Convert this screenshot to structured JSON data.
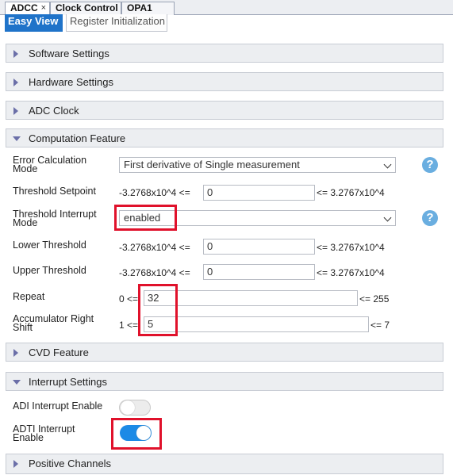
{
  "doc_tabs": [
    {
      "label": "ADCC",
      "close": "×"
    },
    {
      "label": "Clock Control"
    },
    {
      "label": "OPA1"
    }
  ],
  "view_tabs": {
    "active": "Easy View",
    "inactive": "Register Initialization"
  },
  "sections": {
    "software": "Software Settings",
    "hardware": "Hardware Settings",
    "adc_clock": "ADC Clock",
    "computation": "Computation Feature",
    "cvd": "CVD Feature",
    "interrupt": "Interrupt Settings",
    "positive": "Positive Channels"
  },
  "computation": {
    "error_calc": {
      "label_line1": "Error Calculation",
      "label_line2": "Mode",
      "value": "First derivative of Single measurement"
    },
    "threshold_setpoint": {
      "label": "Threshold Setpoint",
      "min": "-3.2768x10^4 <=",
      "value": "0",
      "max": "<= 3.2767x10^4"
    },
    "threshold_interrupt": {
      "label_line1": "Threshold Interrupt",
      "label_line2": "Mode",
      "value": "enabled"
    },
    "lower_threshold": {
      "label": "Lower Threshold",
      "min": "-3.2768x10^4 <=",
      "value": "0",
      "max": "<= 3.2767x10^4"
    },
    "upper_threshold": {
      "label": "Upper Threshold",
      "min": "-3.2768x10^4 <=",
      "value": "0",
      "max": "<= 3.2767x10^4"
    },
    "repeat": {
      "label": "Repeat",
      "min": "0 <=",
      "value": "32",
      "max": "<= 255"
    },
    "acc_right_shift": {
      "label_line1": "Accumulator Right",
      "label_line2": "Shift",
      "min": "1 <=",
      "value": "5",
      "max": "<= 7"
    }
  },
  "interrupts": {
    "adi": {
      "label": "ADI Interrupt Enable",
      "enabled": false
    },
    "adti": {
      "label_line1": "ADTI Interrupt",
      "label_line2": "Enable",
      "enabled": true
    }
  },
  "help_glyph": "?",
  "colors": {
    "accent": "#1f73c9",
    "highlight": "#e0112b",
    "toggle_on": "#1c8ae6"
  }
}
